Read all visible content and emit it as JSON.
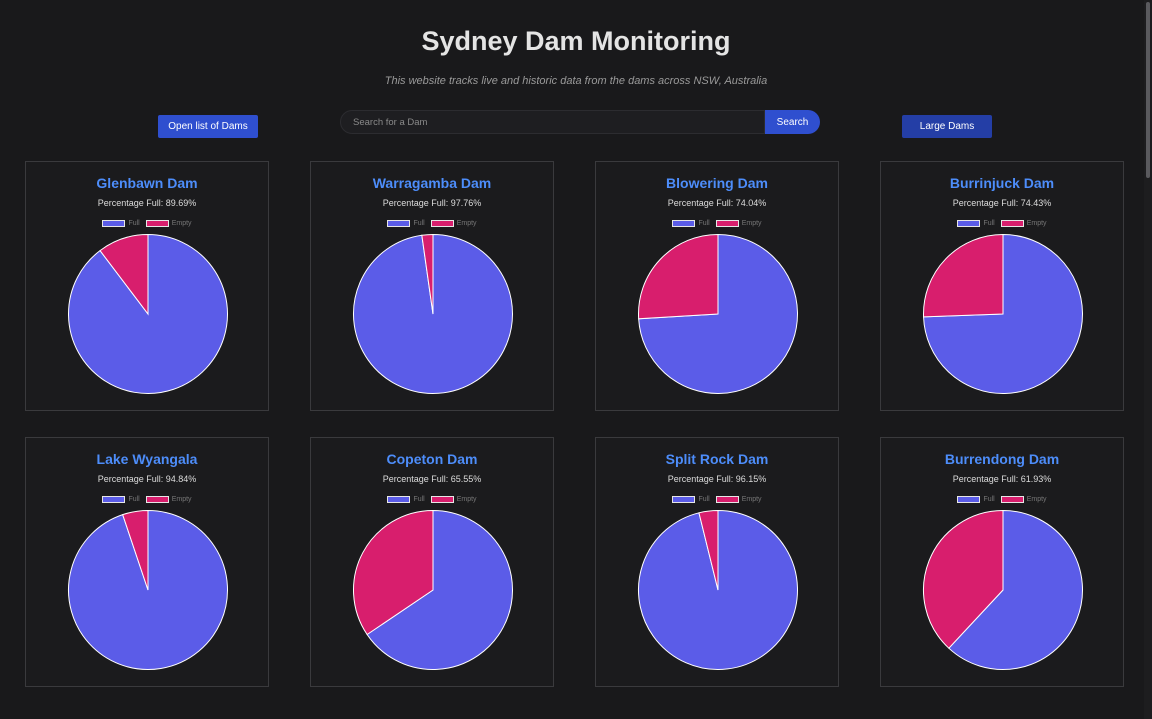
{
  "header": {
    "title": "Sydney Dam Monitoring",
    "subtitle": "This website tracks live and historic data from the dams across NSW, Australia"
  },
  "toolbar": {
    "open_list_label": "Open list of Dams",
    "large_dams_label": "Large Dams",
    "search_placeholder": "Search for a Dam",
    "search_value": "",
    "search_button_label": "Search"
  },
  "colors": {
    "full": "#5b5ce8",
    "empty": "#d81e6d",
    "title": "#4d8dfa"
  },
  "legend": {
    "full_label": "Full",
    "empty_label": "Empty"
  },
  "dams": [
    {
      "name": "Glenbawn Dam",
      "percent_label": "Percentage Full: 89.69%",
      "full": 89.69
    },
    {
      "name": "Warragamba Dam",
      "percent_label": "Percentage Full: 97.76%",
      "full": 97.76
    },
    {
      "name": "Blowering Dam",
      "percent_label": "Percentage Full: 74.04%",
      "full": 74.04
    },
    {
      "name": "Burrinjuck Dam",
      "percent_label": "Percentage Full: 74.43%",
      "full": 74.43
    },
    {
      "name": "Lake Wyangala",
      "percent_label": "Percentage Full: 94.84%",
      "full": 94.84
    },
    {
      "name": "Copeton Dam",
      "percent_label": "Percentage Full: 65.55%",
      "full": 65.55
    },
    {
      "name": "Split Rock Dam",
      "percent_label": "Percentage Full: 96.15%",
      "full": 96.15
    },
    {
      "name": "Burrendong Dam",
      "percent_label": "Percentage Full: 61.93%",
      "full": 61.93
    }
  ],
  "chart_data": [
    {
      "type": "pie",
      "title": "Glenbawn Dam",
      "labels": [
        "Full",
        "Empty"
      ],
      "values": [
        89.69,
        10.31
      ]
    },
    {
      "type": "pie",
      "title": "Warragamba Dam",
      "labels": [
        "Full",
        "Empty"
      ],
      "values": [
        97.76,
        2.24
      ]
    },
    {
      "type": "pie",
      "title": "Blowering Dam",
      "labels": [
        "Full",
        "Empty"
      ],
      "values": [
        74.04,
        25.96
      ]
    },
    {
      "type": "pie",
      "title": "Burrinjuck Dam",
      "labels": [
        "Full",
        "Empty"
      ],
      "values": [
        74.43,
        25.57
      ]
    },
    {
      "type": "pie",
      "title": "Lake Wyangala",
      "labels": [
        "Full",
        "Empty"
      ],
      "values": [
        94.84,
        5.16
      ]
    },
    {
      "type": "pie",
      "title": "Copeton Dam",
      "labels": [
        "Full",
        "Empty"
      ],
      "values": [
        65.55,
        34.45
      ]
    },
    {
      "type": "pie",
      "title": "Split Rock Dam",
      "labels": [
        "Full",
        "Empty"
      ],
      "values": [
        96.15,
        3.85
      ]
    },
    {
      "type": "pie",
      "title": "Burrendong Dam",
      "labels": [
        "Full",
        "Empty"
      ],
      "values": [
        61.93,
        38.07
      ]
    }
  ]
}
